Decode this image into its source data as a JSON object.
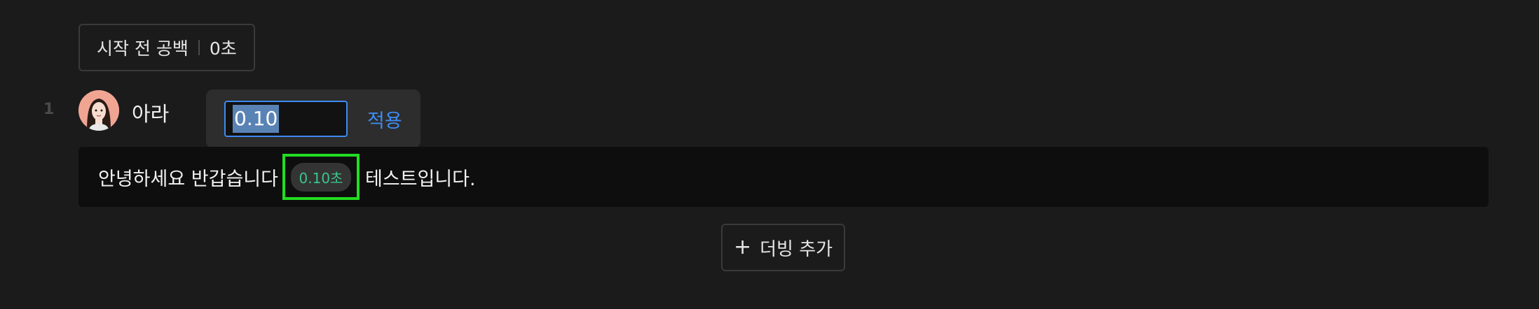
{
  "pregap": {
    "label": "시작 전 공백",
    "value": "0초"
  },
  "row": {
    "number": "1",
    "speaker": "아라"
  },
  "popover": {
    "input_value": "0.10",
    "apply_label": "적용"
  },
  "sentence": {
    "before": "안녕하세요 반갑습니다",
    "pause_chip": "0.10초",
    "after": "테스트입니다."
  },
  "add_button": {
    "icon": "plus-icon",
    "label": "더빙 추가"
  },
  "colors": {
    "background": "#1b1b1b",
    "accent_blue": "#3d8bf2",
    "pause_text": "#3cc48c",
    "highlight_box": "#22dd22"
  }
}
